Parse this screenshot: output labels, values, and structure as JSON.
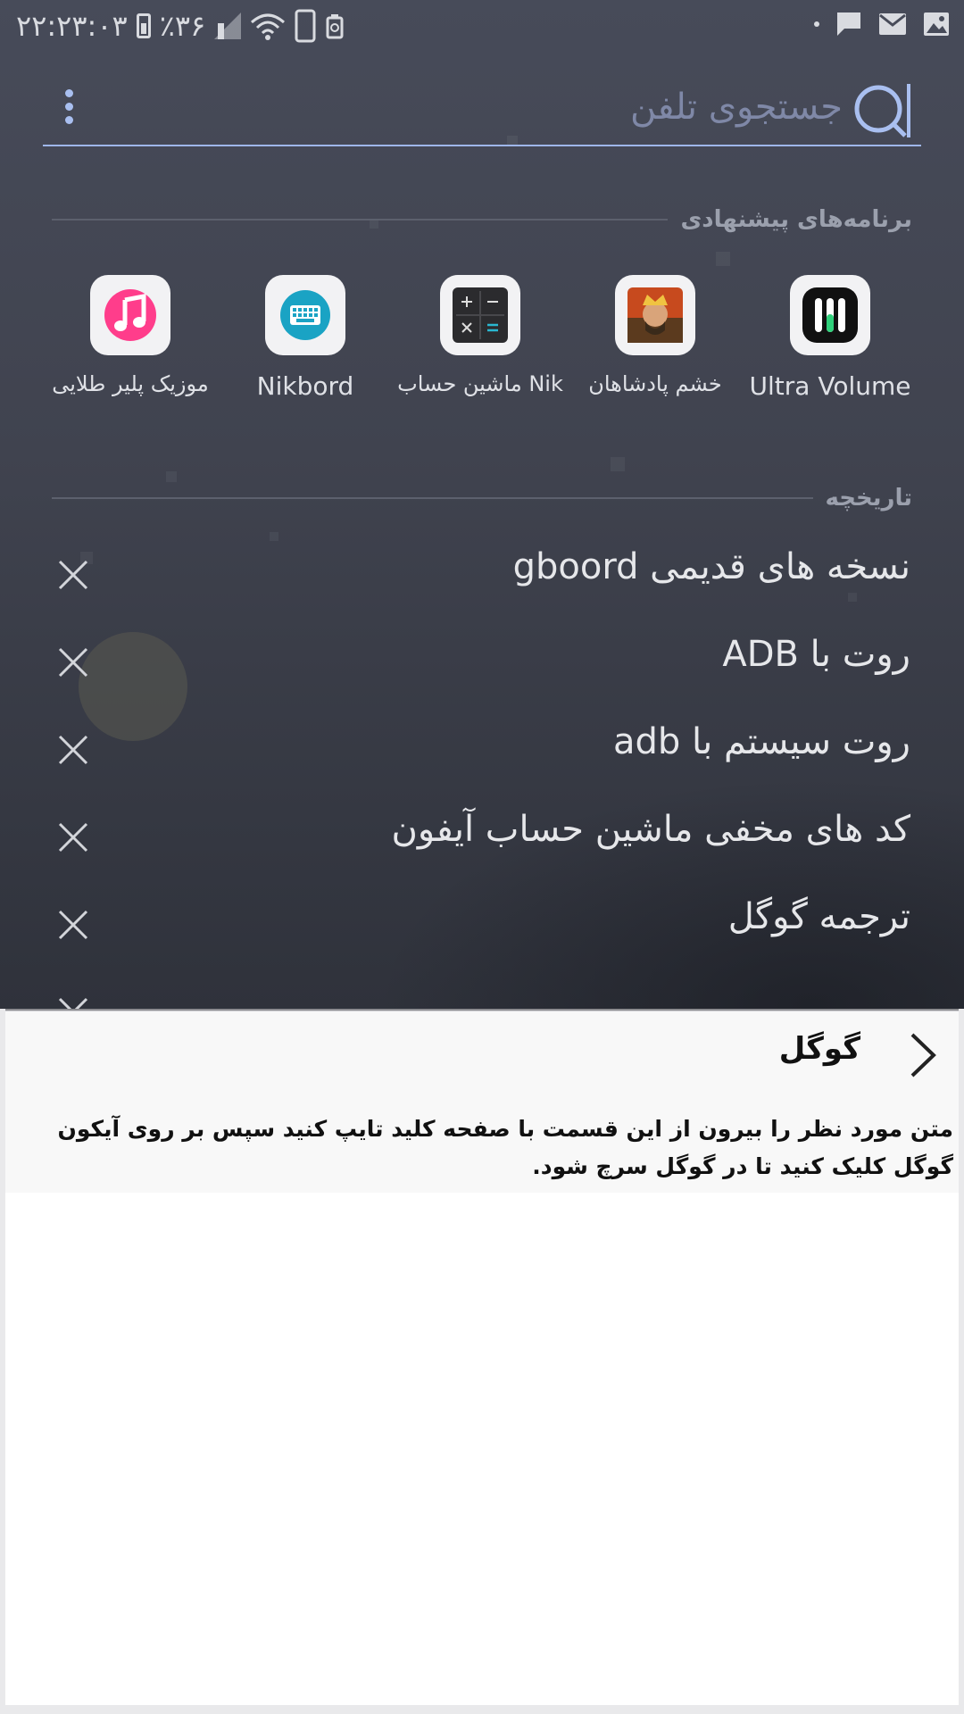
{
  "status_bar": {
    "time": "۲۲:۲۳:۰۳",
    "battery": "٪۳۶"
  },
  "search": {
    "placeholder": "جستجوی تلفن"
  },
  "suggested_apps": {
    "title": "برنامه‌های پیشنهادی",
    "items": [
      {
        "label": "Ultra Volume",
        "icon": "equalizer-icon"
      },
      {
        "label": "خشم پادشاهان",
        "icon": "king-portrait-icon"
      },
      {
        "label": "ماشین حساب Nik",
        "icon": "calculator-icon"
      },
      {
        "label": "Nikbord",
        "icon": "keyboard-icon"
      },
      {
        "label": "موزیک پلیر طلایی",
        "icon": "music-note-icon"
      }
    ]
  },
  "history": {
    "title": "تاریخچه",
    "items": [
      "نسخه های قدیمی gboord",
      "روت با ADB",
      "روت سیستم با adb",
      "کد های مخفی ماشین حساب آیفون",
      "ترجمه گوگل"
    ]
  },
  "sheet": {
    "title": "گوگل",
    "description": "متن مورد نظر را بیرون از این قسمت با صفحه کلید تایپ کنید سپس بر روی آیکون گوگل کلیک کنید تا در گوگل سرچ شود."
  },
  "colors": {
    "accent": "#9fb6ea",
    "background_top": "#474b59",
    "music_pink": "#ff3d8b",
    "keyboard_teal": "#1aa3c4"
  }
}
